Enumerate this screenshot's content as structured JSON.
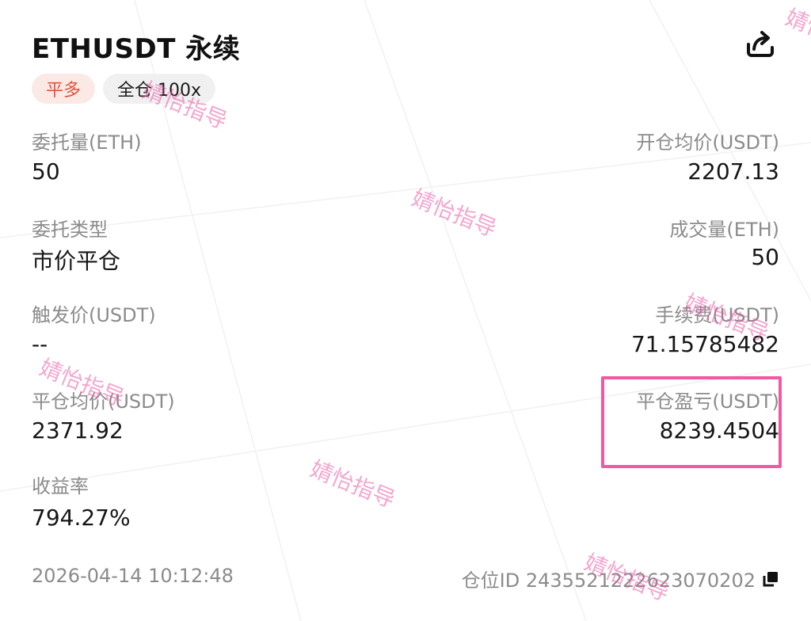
{
  "header": {
    "title": "ETHUSDT 永续",
    "share_icon": "share-icon"
  },
  "tags": {
    "side": "平多",
    "margin": "全仓 100x"
  },
  "fields": {
    "order_qty_label": "委托量(ETH)",
    "order_qty_value": "50",
    "open_avg_label": "开仓均价(USDT)",
    "open_avg_value": "2207.13",
    "order_type_label": "委托类型",
    "order_type_value": "市价平仓",
    "filled_qty_label": "成交量(ETH)",
    "filled_qty_value": "50",
    "trigger_label": "触发价(USDT)",
    "trigger_value": "--",
    "fee_label": "手续费(USDT)",
    "fee_value": "71.15785482",
    "close_avg_label": "平仓均价(USDT)",
    "close_avg_value": "2371.92",
    "pnl_label": "平仓盈亏(USDT)",
    "pnl_value": "8239.4504",
    "roi_label": "收益率",
    "roi_value": "794.27%"
  },
  "footer": {
    "time": "2026-04-14 10:12:48",
    "position_id": "仓位ID 2435521222623070202"
  },
  "watermark": {
    "text": "婧怡指导"
  },
  "colors": {
    "side_tag_bg": "#fbe9e6",
    "side_tag_text": "#e0533b",
    "highlight": "#ee5aa4",
    "watermark": "#e85caa",
    "label": "#8b8b8b"
  }
}
